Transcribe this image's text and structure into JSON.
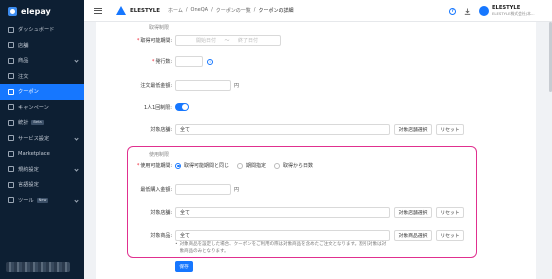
{
  "sidebar": {
    "logo": "elepay",
    "items": [
      {
        "label": "ダッシュボード",
        "icon": "home-icon"
      },
      {
        "label": "店舗",
        "icon": "store-icon"
      },
      {
        "label": "商品",
        "icon": "tag-icon",
        "expandable": true
      },
      {
        "label": "注文",
        "icon": "order-icon"
      },
      {
        "label": "クーポン",
        "icon": "coupon-icon",
        "active": true
      },
      {
        "label": "キャンペーン",
        "icon": "campaign-icon"
      },
      {
        "label": "統計",
        "icon": "chart-icon",
        "badge": "Beta"
      },
      {
        "label": "サービス設定",
        "icon": "gear-icon",
        "expandable": true
      },
      {
        "label": "Marketplace",
        "icon": "marketplace-icon"
      },
      {
        "label": "規約設定",
        "icon": "document-icon",
        "expandable": true
      },
      {
        "label": "言語設定",
        "icon": "language-icon"
      },
      {
        "label": "ツール",
        "icon": "tool-icon",
        "badge": "New",
        "expandable": true
      }
    ]
  },
  "header": {
    "brand": "ELESTYLE",
    "breadcrumb": [
      "ホーム",
      "OneQA",
      "クーポンの一覧",
      "クーポンの詳細"
    ],
    "user_name": "ELESTYLE",
    "user_sub": "ELESTYLE株式会社(本..."
  },
  "form": {
    "top_section_title": "取得制限",
    "period_label": "取得可能期間:",
    "period_start_ph": "開始日付",
    "period_sep": "〜",
    "period_end_ph": "終了日付",
    "issue_label": "発行数:",
    "min_amount_label": "注文最低金額:",
    "yen": "円",
    "one_per_person_label": "1人1回制限:",
    "target_store_label": "対象店舗:",
    "target_store_value": "全て",
    "select_store_btn": "対象店舗選択",
    "reset_btn": "リセット"
  },
  "usage": {
    "section_title": "使用制限",
    "period_label": "使用可能期間:",
    "period_options": [
      "取得可能期間と同じ",
      "期間指定",
      "取得から日数"
    ],
    "min_amount_label": "最低購入金額:",
    "yen": "円",
    "target_store_label": "対象店舗:",
    "target_store_value": "全て",
    "select_store_btn": "対象店舗選択",
    "target_product_label": "対象商品:",
    "target_product_value": "全て",
    "select_product_btn": "対象商品選択",
    "reset_btn": "リセット",
    "note": "対象商品を設定した場合、クーポンをご利用の際は対象商品を含めたご注文となります。割引対象は対象商品のみとなります。"
  },
  "save_btn": "保存",
  "colors": {
    "accent": "#1677ff",
    "sidebar_bg": "#0d1f33",
    "highlight": "#e0308f"
  }
}
